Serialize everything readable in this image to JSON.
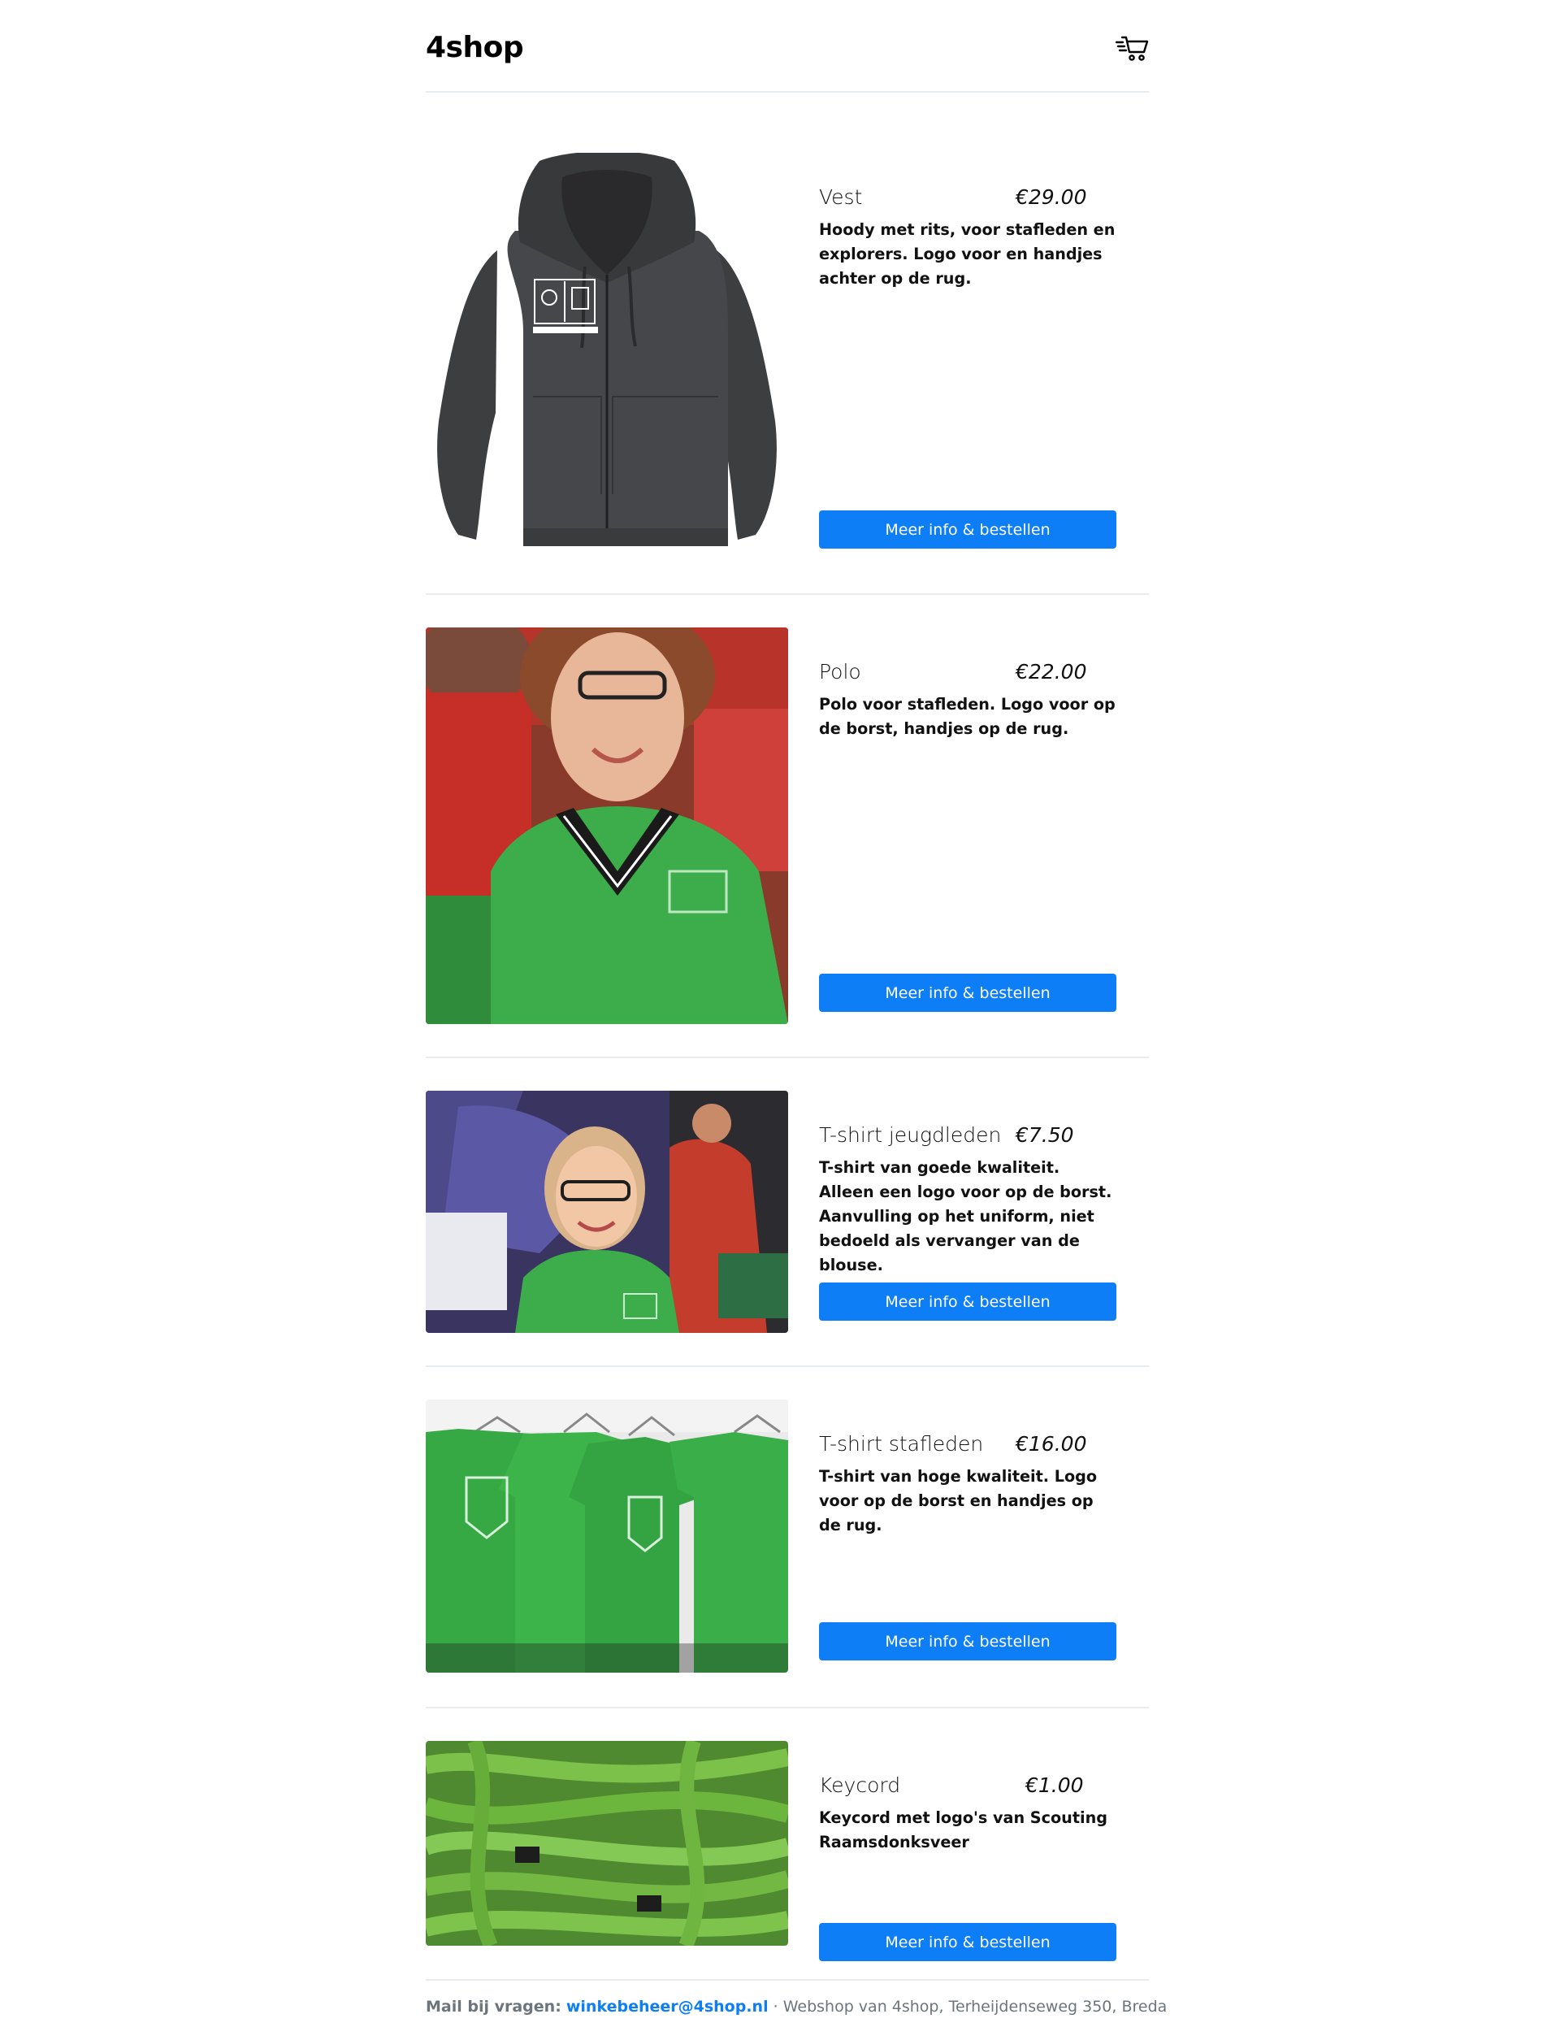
{
  "app": {
    "logo": "4shop"
  },
  "header": {
    "cart_icon": "shopping-cart-icon"
  },
  "colors": {
    "accent": "#0d7ef6",
    "divider": "#e9ecef",
    "muted": "#6c757d"
  },
  "products": [
    {
      "name": "Vest",
      "price": "€29.00",
      "description": "Hoody met rits, voor stafleden en explorers. Logo voor en handjes achter op de rug.",
      "button": "Meer info & bestellen"
    },
    {
      "name": "Polo",
      "price": "€22.00",
      "description": "Polo voor stafleden. Logo voor op de borst, handjes op de rug.",
      "button": "Meer info & bestellen"
    },
    {
      "name": "T-shirt jeugdleden",
      "price": "€7.50",
      "description": "T-shirt van goede kwaliteit. Alleen een logo voor op de borst. Aanvulling op het uniform, niet bedoeld als vervanger van de blouse.",
      "button": "Meer info & bestellen"
    },
    {
      "name": "T-shirt stafleden",
      "price": "€16.00",
      "description": "T-shirt van hoge kwaliteit. Logo voor op de borst en handjes op de rug.",
      "button": "Meer info & bestellen"
    },
    {
      "name": "Keycord",
      "price": "€1.00",
      "description": "Keycord met logo's van Scouting Raamsdonksveer",
      "button": "Meer info & bestellen"
    }
  ],
  "footer": {
    "label": "Mail bij vragen:",
    "email": "winkebeheer@4shop.nl",
    "rest": " · Webshop van 4shop, Terheijdenseweg 350, Breda"
  }
}
